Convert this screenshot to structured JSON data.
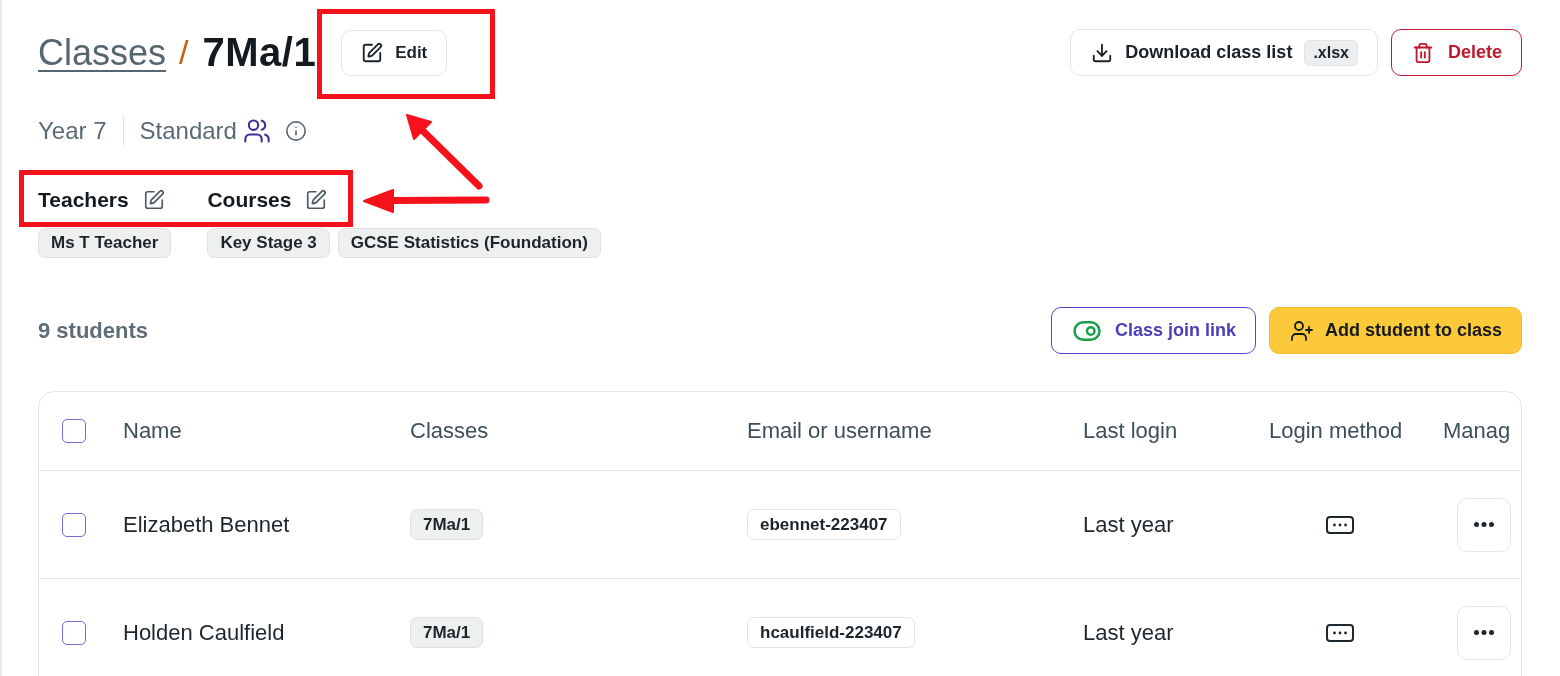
{
  "breadcrumb": {
    "parent": "Classes",
    "separator": "/",
    "current": "7Ma/1"
  },
  "edit_button": {
    "label": "Edit",
    "highlighted": true
  },
  "header_actions": [
    {
      "kind": "download",
      "label": "Download class list",
      "badge": ".xlsx"
    },
    {
      "kind": "delete",
      "label": "Delete"
    }
  ],
  "class_info": {
    "year": "Year 7",
    "type": "Standard"
  },
  "assignments": {
    "highlighted": true,
    "groups": [
      {
        "title": "Teachers",
        "tags": [
          "Ms T Teacher"
        ]
      },
      {
        "title": "Courses",
        "tags": [
          "Key Stage 3",
          "GCSE Statistics (Foundation)"
        ]
      }
    ]
  },
  "students": {
    "count": "9 students",
    "actions": [
      {
        "kind": "join_link",
        "label": "Class join link"
      },
      {
        "kind": "add_student",
        "label": "Add student to class"
      }
    ]
  },
  "table": {
    "select_all": {
      "checked": false
    },
    "columns": [
      "Name",
      "Classes",
      "Email or username",
      "Last login",
      "Login method",
      "Manag"
    ],
    "rows": [
      {
        "checked": false,
        "name": "Elizabeth Bennet",
        "classes": [
          "7Ma/1"
        ],
        "username": "ebennet-223407",
        "last_login": "Last year",
        "login_method": {
          "kind": "password"
        }
      },
      {
        "checked": false,
        "name": "Holden Caulfield",
        "classes": [
          "7Ma/1"
        ],
        "username": "hcaulfield-223407",
        "last_login": "Last year",
        "login_method": {
          "kind": "password"
        }
      }
    ]
  }
}
